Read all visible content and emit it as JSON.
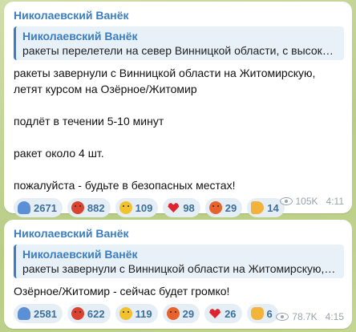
{
  "messages": [
    {
      "channel_name": "Николаевский Ванёк",
      "reply": {
        "author": "Николаевский Ванёк",
        "text": "ракеты перелетели на север Винницкой области, с высокой в..."
      },
      "paragraphs": [
        "ракеты завернули с Винницкой области на Житомирскую, летят курсом на Озёрное/Житомир",
        "подлёт в течении 5-10 минут",
        "ракет около 4 шт.",
        "пожалуйста - будьте в безопасных местах!"
      ],
      "reactions": [
        {
          "icon": "folded-hands-icon",
          "count": "2671"
        },
        {
          "icon": "angry-face-with-symbols-icon",
          "count": "882"
        },
        {
          "icon": "crying-face-icon",
          "count": "109"
        },
        {
          "icon": "red-heart-icon",
          "count": "98"
        },
        {
          "icon": "angry-face-icon",
          "count": "29"
        },
        {
          "icon": "pointing-hand-icon",
          "count": "14"
        }
      ],
      "views": "105K",
      "time": "4:11"
    },
    {
      "channel_name": "Николаевский Ванёк",
      "reply": {
        "author": "Николаевский Ванёк",
        "text": "ракеты завернули с Винницкой области на Житомирскую, ле..."
      },
      "paragraphs": [
        "Озёрное/Житомир - сейчас будет громко!"
      ],
      "reactions": [
        {
          "icon": "folded-hands-icon",
          "count": "2581"
        },
        {
          "icon": "angry-face-with-symbols-icon",
          "count": "622"
        },
        {
          "icon": "crying-face-icon",
          "count": "119"
        },
        {
          "icon": "angry-face-icon",
          "count": "29"
        },
        {
          "icon": "red-heart-icon",
          "count": "26"
        },
        {
          "icon": "thumbs-up-icon",
          "count": "6"
        }
      ],
      "views": "78.7K",
      "time": "4:15"
    }
  ],
  "colors": {
    "accent": "#3a7ec0",
    "reaction_bg": "#e6eef5",
    "meta_text": "#9aa3ab"
  }
}
